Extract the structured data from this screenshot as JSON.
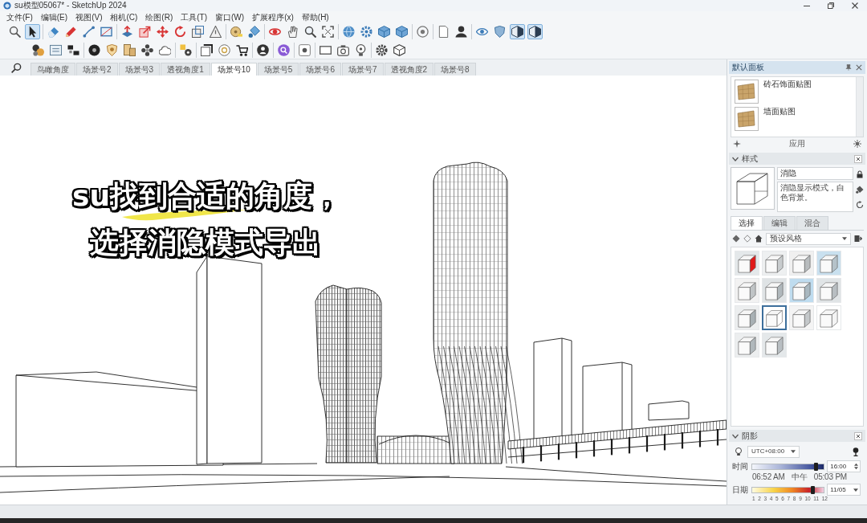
{
  "window": {
    "title": "su模型05067* - SketchUp 2024"
  },
  "menu": [
    "文件(F)",
    "编辑(E)",
    "视图(V)",
    "相机(C)",
    "绘图(R)",
    "工具(T)",
    "窗口(W)",
    "扩展程序(x)",
    "帮助(H)"
  ],
  "toolbar_rows": [
    {
      "groups": [
        [
          {
            "selected": false
          },
          {
            "selected": true
          }
        ],
        [
          {
            "selected": false
          },
          {
            "selected": false
          },
          {
            "selected": false
          },
          {
            "selected": false
          }
        ],
        [
          {
            "selected": false
          },
          {
            "selected": false
          },
          {
            "selected": false
          },
          {
            "selected": false
          },
          {
            "selected": false
          },
          {
            "selected": false
          }
        ],
        [
          {
            "selected": false
          },
          {
            "selected": false
          }
        ],
        [
          {
            "selected": false
          },
          {
            "selected": false
          },
          {
            "selected": false
          },
          {
            "selected": false
          }
        ],
        [
          {
            "selected": false
          },
          {
            "selected": false
          },
          {
            "selected": false
          },
          {
            "selected": false
          }
        ],
        [
          {
            "selected": false
          }
        ],
        [
          {
            "selected": false
          },
          {
            "selected": false
          }
        ],
        [
          {
            "selected": false
          },
          {
            "selected": false
          },
          {
            "selected": true
          },
          {
            "selected": true
          }
        ]
      ]
    },
    {
      "groups": [
        [
          {
            "selected": false
          },
          {
            "selected": false
          },
          {
            "selected": false
          }
        ],
        [
          {
            "selected": false
          },
          {
            "selected": false
          },
          {
            "selected": false
          },
          {
            "selected": false
          },
          {
            "selected": false
          }
        ],
        [
          {
            "selected": false
          }
        ],
        [
          {
            "selected": false
          },
          {
            "selected": false
          },
          {
            "selected": false
          }
        ],
        [
          {
            "selected": false
          }
        ],
        [
          {
            "selected": false
          }
        ],
        [
          {
            "selected": false
          }
        ],
        [
          {
            "selected": false
          },
          {
            "selected": false
          },
          {
            "selected": false
          }
        ],
        [
          {
            "selected": false
          },
          {
            "selected": false
          }
        ]
      ]
    }
  ],
  "scene_tabs": [
    {
      "label": "鸟瞰角度",
      "selected": false
    },
    {
      "label": "场景号2",
      "selected": false
    },
    {
      "label": "场景号3",
      "selected": false
    },
    {
      "label": "透视角度1",
      "selected": false
    },
    {
      "label": "场景号10",
      "selected": true
    },
    {
      "label": "场景号5",
      "selected": false
    },
    {
      "label": "场景号6",
      "selected": false
    },
    {
      "label": "场景号7",
      "selected": false
    },
    {
      "label": "透视角度2",
      "selected": false
    },
    {
      "label": "场景号8",
      "selected": false
    }
  ],
  "caption": [
    "su找到合适的角度，",
    "选择消隐模式导出"
  ],
  "tray": {
    "title": "默认面板",
    "materials": {
      "items": [
        {
          "name": "砖石饰面贴图"
        },
        {
          "name": "墙面贴图"
        }
      ],
      "action": "应用"
    },
    "styles": {
      "title": "样式",
      "expanded": true,
      "name": "消隐",
      "description": "消隐显示模式，白色背景。",
      "tabs": [
        {
          "label": "选择",
          "selected": true
        },
        {
          "label": "编辑",
          "selected": false
        },
        {
          "label": "混合",
          "selected": false
        }
      ],
      "collection": "预设风格",
      "thumbnails": [
        {
          "selected": false
        },
        {
          "selected": false
        },
        {
          "selected": false
        },
        {
          "selected": false
        },
        {
          "selected": false
        },
        {
          "selected": false
        },
        {
          "selected": false
        },
        {
          "selected": false
        },
        {
          "selected": false
        },
        {
          "selected": true
        },
        {
          "selected": false
        },
        {
          "selected": false
        },
        {
          "selected": false
        },
        {
          "selected": false
        }
      ]
    },
    "shadows": {
      "title": "阴影",
      "expanded": true,
      "timezone": "UTC+08:00",
      "time": {
        "label": "时间",
        "level": 0.9,
        "ticks": [
          "06:52 AM",
          "中午",
          "05:03 PM"
        ],
        "value": "16:00"
      },
      "date": {
        "label": "日期",
        "level": 0.85,
        "ticks": [
          "1",
          "2",
          "3",
          "4",
          "5",
          "6",
          "7",
          "8",
          "9",
          "10",
          "11",
          "12"
        ],
        "value": "11/05"
      }
    }
  }
}
